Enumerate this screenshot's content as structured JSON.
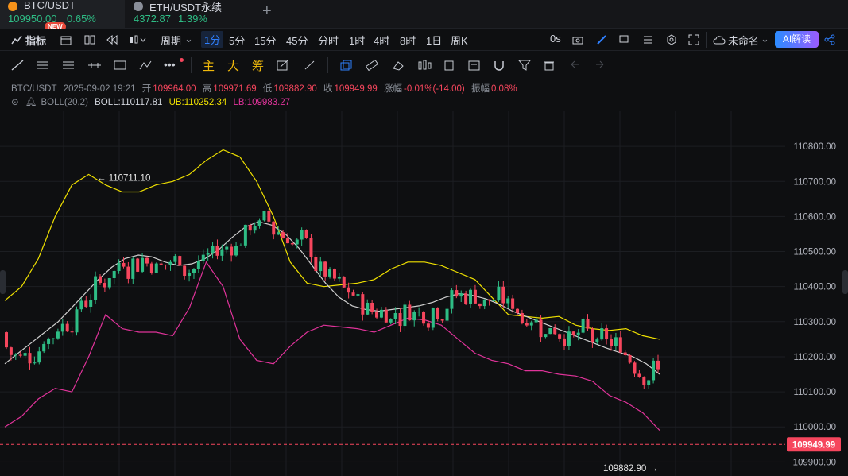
{
  "tabs": [
    {
      "symbol": "BTC/USDT",
      "price": "109950.00",
      "change": "0.65%",
      "badge": "NEW",
      "active": true
    },
    {
      "symbol": "ETH/USDT永续",
      "price": "4372.87",
      "change": "1.39%",
      "active": false
    }
  ],
  "toolbar": {
    "indicators_label": "指标",
    "period_label": "周期",
    "intervals": [
      "1分",
      "5分",
      "15分",
      "45分",
      "分时",
      "1时",
      "4时",
      "8时",
      "1日",
      "周K"
    ],
    "active_interval": "1分",
    "timer": "0s",
    "layout_name": "未命名",
    "ai_label": "AI解读"
  },
  "drawing_tools": {
    "main_label": "主",
    "big_label": "大",
    "chips_label": "筹"
  },
  "info": {
    "symbol": "BTC/USDT",
    "datetime": "2025-09-02 19:21",
    "open_label": "开",
    "open": "109964.00",
    "high_label": "高",
    "high": "109971.69",
    "low_label": "低",
    "low": "109882.90",
    "close_label": "收",
    "close": "109949.99",
    "change_label": "涨幅",
    "change": "-0.01%(-14.00)",
    "amp_label": "振幅",
    "amp": "0.08%",
    "boll_label": "BOLL(20,2)",
    "boll": "BOLL:110117.81",
    "ub": "UB:110252.34",
    "lb": "LB:109983.27"
  },
  "colors": {
    "up": "#2ebd85",
    "down": "#f6465d",
    "boll_mid": "#d0d0d0",
    "boll_ub": "#f0e100",
    "boll_lb": "#e0339a",
    "accent": "#2f80ff"
  },
  "chart_data": {
    "type": "candlestick",
    "ylim": [
      109860,
      110900
    ],
    "y_ticks": [
      "110800.00",
      "110700.00",
      "110600.00",
      "110500.00",
      "110400.00",
      "110300.00",
      "110200.00",
      "110100.00",
      "110000.00",
      "109900.00"
    ],
    "current_price": "109949.99",
    "max_label": "110711.10",
    "min_label": "109882.90",
    "boll_mid": [
      110180,
      110210,
      110240,
      110270,
      110300,
      110340,
      110380,
      110420,
      110455,
      110480,
      110490,
      110485,
      110470,
      110460,
      110465,
      110480,
      110505,
      110540,
      110570,
      110585,
      110575,
      110550,
      110510,
      110460,
      110410,
      110370,
      110345,
      110335,
      110330,
      110335,
      110340,
      110345,
      110355,
      110370,
      110380,
      110375,
      110365,
      110350,
      110330,
      110315,
      110300,
      110285,
      110270,
      110255,
      110240,
      110225,
      110212,
      110200,
      110180,
      110150
    ],
    "boll_ub": [
      110360,
      110400,
      110480,
      110600,
      110690,
      110720,
      110690,
      110670,
      110670,
      110690,
      110700,
      110720,
      110760,
      110790,
      110770,
      110700,
      110600,
      110470,
      110410,
      110400,
      110405,
      110410,
      110420,
      110450,
      110470,
      110470,
      110460,
      110440,
      110420,
      110370,
      110320,
      110315,
      110310,
      110315,
      110290,
      110280,
      110275,
      110280,
      110260,
      110250
    ],
    "boll_lb": [
      110000,
      110030,
      110080,
      110110,
      110100,
      110200,
      110320,
      110280,
      110270,
      110270,
      110260,
      110340,
      110470,
      110400,
      110250,
      110190,
      110180,
      110230,
      110270,
      110290,
      110285,
      110280,
      110270,
      110290,
      110310,
      110305,
      110290,
      110250,
      110210,
      110190,
      110180,
      110160,
      110160,
      110150,
      110145,
      110130,
      110090,
      110070,
      110040,
      109990
    ]
  }
}
